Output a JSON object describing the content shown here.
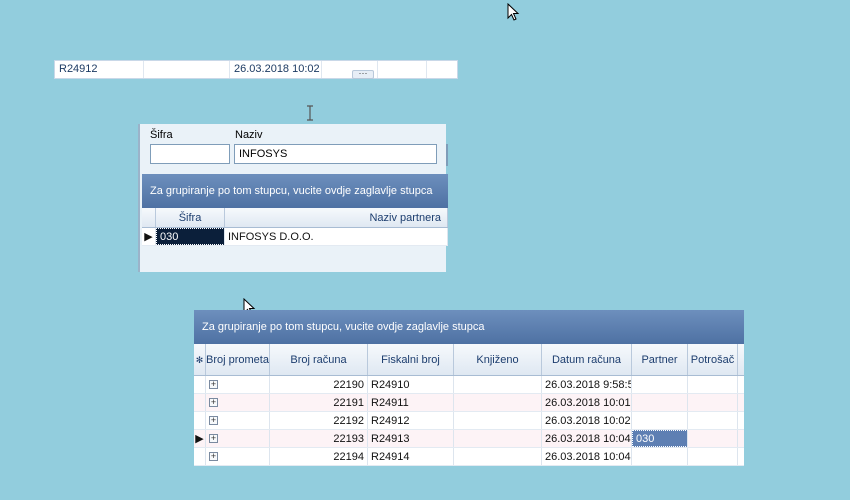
{
  "top_strip": {
    "cells": [
      "R24912",
      "",
      "26.03.2018 10:02",
      "",
      "",
      ""
    ]
  },
  "partner_panel": {
    "sifra_label": "Šifra",
    "naziv_label": "Naziv",
    "sifra_value": "",
    "naziv_value": "INFOSYS",
    "group_hint": "Za grupiranje po tom stupcu, vucite ovdje zaglavlje stupca",
    "columns": [
      "Šifra",
      "Naziv partnera"
    ],
    "rows": [
      {
        "sifra": "030",
        "naziv": "INFOSYS D.O.O."
      }
    ]
  },
  "main_grid": {
    "group_hint": "Za grupiranje po tom stupcu, vucite ovdje zaglavlje stupca",
    "columns": [
      "Broj prometa",
      "Broj računa",
      "Fiskalni broj",
      "Knjiženo",
      "Datum računa",
      "Partner",
      "Potrošač"
    ],
    "rows": [
      {
        "broj_racuna": "22190",
        "fiskalni": "R24910",
        "knjizeno": "",
        "datum": "26.03.2018 9:58:5",
        "partner": "",
        "potrosac": ""
      },
      {
        "broj_racuna": "22191",
        "fiskalni": "R24911",
        "knjizeno": "",
        "datum": "26.03.2018 10:01",
        "partner": "",
        "potrosac": ""
      },
      {
        "broj_racuna": "22192",
        "fiskalni": "R24912",
        "knjizeno": "",
        "datum": "26.03.2018 10:02",
        "partner": "",
        "potrosac": ""
      },
      {
        "broj_racuna": "22193",
        "fiskalni": "R24913",
        "knjizeno": "",
        "datum": "26.03.2018 10:04",
        "partner": "030",
        "potrosac": ""
      },
      {
        "broj_racuna": "22194",
        "fiskalni": "R24914",
        "knjizeno": "",
        "datum": "26.03.2018 10:04",
        "partner": "",
        "potrosac": ""
      }
    ],
    "expander_symbol": "+",
    "current_row_indicator": "▶"
  },
  "colors": {
    "desktop": "#92cddd",
    "group_header": "#5a7cac",
    "selection": "#5e7fb3"
  }
}
